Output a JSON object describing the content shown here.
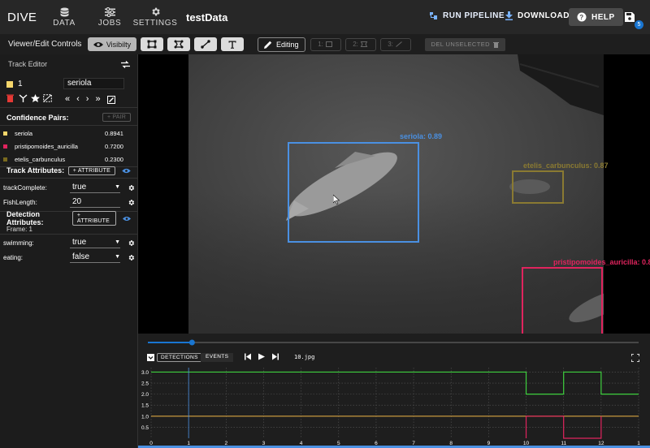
{
  "app": {
    "brand": "DIVE",
    "project_name": "testData"
  },
  "nav": {
    "data": "DATA",
    "jobs": "JOBS",
    "settings": "SETTINGS"
  },
  "top_actions": {
    "run_pipeline": "RUN PIPELINE",
    "download": "DOWNLOAD",
    "help": "HELP",
    "save_badge": "5"
  },
  "toolbar": {
    "label": "Viewer/Edit Controls",
    "visibility": "Visibilty",
    "editing": "Editing",
    "mode1": "1:",
    "mode2": "2:",
    "mode3": "3:",
    "del_unselected": "DEL UNSELECTED"
  },
  "track_editor": {
    "title": "Track Editor",
    "track_id": "1",
    "track_type": "seriola",
    "track_color": "#f5d66b"
  },
  "confidence": {
    "title": "Confidence Pairs:",
    "add_label": "+ PAIR",
    "pairs": [
      {
        "name": "seriola",
        "value": "0.8941",
        "color": "#f5d66b"
      },
      {
        "name": "pristipomoides_auricilla",
        "value": "0.7200",
        "color": "#e0245e"
      },
      {
        "name": "etelis_carbunculus",
        "value": "0.2300",
        "color": "#7a6a1e"
      }
    ]
  },
  "track_attributes": {
    "title": "Track Attributes:",
    "add_label": "+ ATTRIBUTE",
    "items": [
      {
        "name": "trackComplete:",
        "value": "true",
        "kind": "select"
      },
      {
        "name": "FishLength:",
        "value": "20",
        "kind": "text"
      }
    ]
  },
  "detection_attributes": {
    "title": "Detection Attributes:",
    "add_label": "+ ATTRIBUTE",
    "frame": "Frame: 1",
    "items": [
      {
        "name": "swimming:",
        "value": "true"
      },
      {
        "name": "eating:",
        "value": "false"
      }
    ]
  },
  "detections": [
    {
      "label": "seriola: 0.89",
      "color": "#4a90e2"
    },
    {
      "label": "etelis_carbunculus: 0.87",
      "color": "#8a7a32"
    },
    {
      "label": "pristipomoides_auricilla: 0.8",
      "color": "#e0245e"
    }
  ],
  "timeline": {
    "tab_detections": "DETECTIONS",
    "tab_events": "EVENTS",
    "filename": "10.jpg",
    "playhead_fraction": 0.09
  },
  "chart_data": {
    "type": "line",
    "x_ticks": [
      "0",
      "1",
      "2",
      "3",
      "4",
      "5",
      "6",
      "7",
      "8",
      "9",
      "10",
      "11",
      "12",
      "1"
    ],
    "y_ticks": [
      "3.0",
      "2.5",
      "2.0",
      "1.5",
      "1.0",
      "0.5"
    ],
    "ylim": [
      0,
      3.2
    ],
    "current_frame": 1,
    "series": [
      {
        "color": "#3ecf3e",
        "x": [
          0,
          10,
          10,
          11,
          11,
          12,
          12,
          13
        ],
        "y": [
          3,
          3,
          2,
          2,
          3,
          3,
          2,
          2
        ]
      },
      {
        "color": "#d9a441",
        "x": [
          0,
          13
        ],
        "y": [
          1,
          1
        ]
      },
      {
        "color": "#e0245e",
        "x": [
          10,
          10,
          11,
          11,
          12,
          12
        ],
        "y": [
          0,
          1,
          1,
          0,
          0,
          1
        ]
      }
    ]
  }
}
